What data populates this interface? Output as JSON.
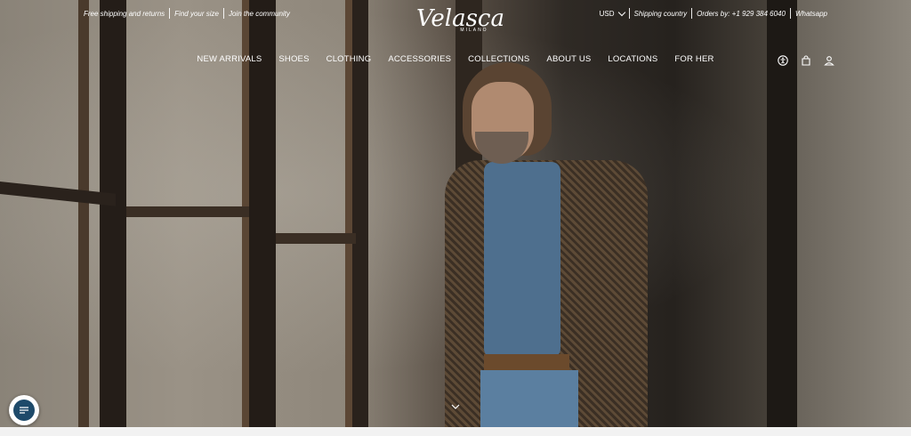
{
  "topbar": {
    "left_links": [
      "Free shipping and returns",
      "Find your size",
      "Join the community"
    ],
    "currency": "USD",
    "shipping": "Shipping country",
    "orders": "Orders by: +1 929 384 6040",
    "whatsapp": "Whatsapp"
  },
  "logo": {
    "main": "Velasca",
    "sub": "MILANO"
  },
  "nav": [
    "NEW ARRIVALS",
    "SHOES",
    "CLOTHING",
    "ACCESSORIES",
    "COLLECTIONS",
    "ABOUT US",
    "LOCATIONS",
    "FOR HER"
  ],
  "icons": [
    "accessibility-icon",
    "shopping-bag-icon",
    "account-icon"
  ],
  "colors": {
    "chat_button": "#1e4a6a",
    "text": "#ffffff"
  }
}
